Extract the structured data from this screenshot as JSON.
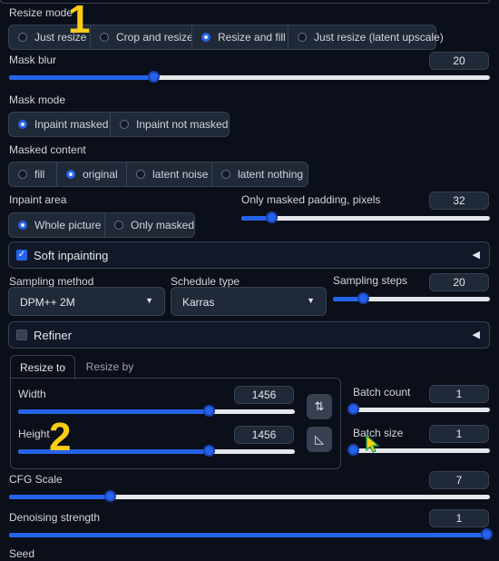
{
  "resize_mode": {
    "label": "Resize mode",
    "options": [
      "Just resize",
      "Crop and resize",
      "Resize and fill",
      "Just resize (latent upscale)"
    ],
    "selected": "Resize and fill"
  },
  "mask_blur": {
    "label": "Mask blur",
    "value": "20",
    "fraction": 0.3
  },
  "mask_mode": {
    "label": "Mask mode",
    "options": [
      "Inpaint masked",
      "Inpaint not masked"
    ],
    "selected": "Inpaint masked"
  },
  "masked_content": {
    "label": "Masked content",
    "options": [
      "fill",
      "original",
      "latent noise",
      "latent nothing"
    ],
    "selected": "original"
  },
  "inpaint_area": {
    "label": "Inpaint area",
    "options": [
      "Whole picture",
      "Only masked"
    ],
    "selected": "Whole picture"
  },
  "only_masked_padding": {
    "label": "Only masked padding, pixels",
    "value": "32",
    "fraction": 0.12
  },
  "soft_inpainting": {
    "label": "Soft inpainting",
    "checked": true,
    "arrow": "◀"
  },
  "sampling_method": {
    "label": "Sampling method",
    "value": "DPM++ 2M",
    "caret": "▼"
  },
  "schedule_type": {
    "label": "Schedule type",
    "value": "Karras",
    "caret": "▼"
  },
  "sampling_steps": {
    "label": "Sampling steps",
    "value": "20",
    "fraction": 0.19
  },
  "refiner": {
    "label": "Refiner",
    "checked": false,
    "arrow": "◀"
  },
  "size_tabs": {
    "tabs": [
      "Resize to",
      "Resize by"
    ],
    "active": "Resize to"
  },
  "width": {
    "label": "Width",
    "value": "1456",
    "fraction": 0.69
  },
  "height": {
    "label": "Height",
    "value": "1456",
    "fraction": 0.69
  },
  "swap_icon": "⇅",
  "ratio_icon": "◺",
  "batch_count": {
    "label": "Batch count",
    "value": "1",
    "fraction": 0.0
  },
  "batch_size": {
    "label": "Batch size",
    "value": "1",
    "fraction": 0.0
  },
  "cfg_scale": {
    "label": "CFG Scale",
    "value": "7",
    "fraction": 0.21
  },
  "denoising_strength": {
    "label": "Denoising strength",
    "value": "1",
    "fraction": 1.0
  },
  "seed": {
    "label": "Seed"
  },
  "annotations": {
    "one": "1",
    "two": "2"
  },
  "colors": {
    "accent": "#2563eb",
    "annotation": "#facc15",
    "background": "#0b0f19"
  }
}
